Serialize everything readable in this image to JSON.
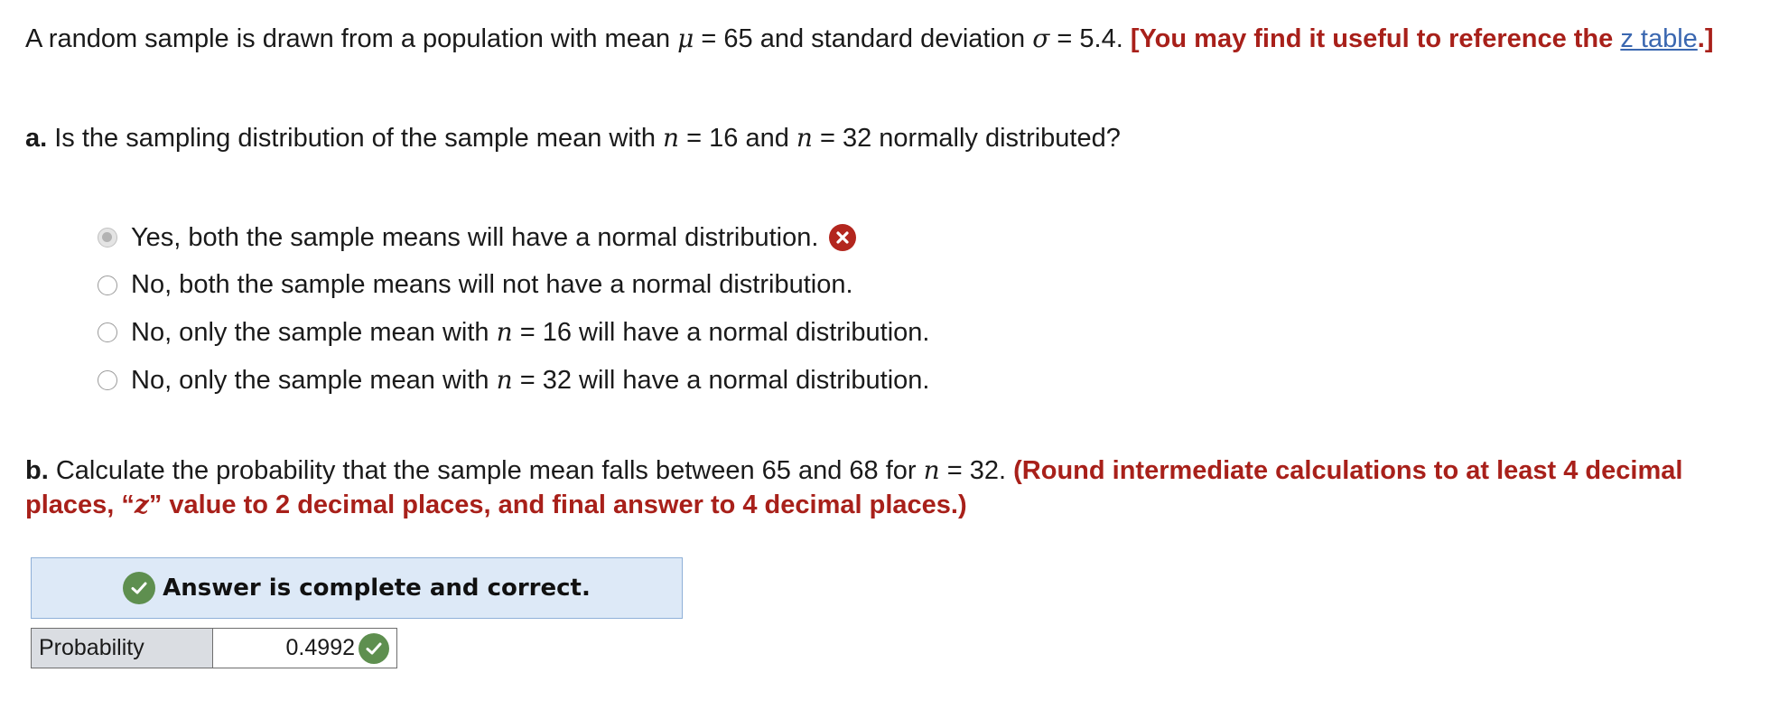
{
  "intro": {
    "text_before_mu": "A random sample is drawn from a population with mean ",
    "mu_symbol": "μ",
    "mu_value": " = 65 and standard deviation ",
    "sigma_symbol": "σ",
    "sigma_value": " = 5.4. ",
    "hint_open": "[You may find it useful to reference the ",
    "link_text": "z table",
    "hint_close": ".]"
  },
  "part_a": {
    "label": "a.",
    "question_before_n1": " Is the sampling distribution of the sample mean with ",
    "n_symbol": "n",
    "n1": " = 16 and ",
    "n2": " = 32 normally distributed?",
    "options": [
      {
        "text": "Yes, both the sample means will have a normal distribution.",
        "selected": true,
        "marked_incorrect": true
      },
      {
        "text": "No, both the sample means will not have a normal distribution.",
        "selected": false
      },
      {
        "before": "No, only the sample mean with ",
        "after": " = 16 will have a normal distribution.",
        "selected": false
      },
      {
        "before": "No, only the sample mean with ",
        "after": " = 32 will have a normal distribution.",
        "selected": false
      }
    ]
  },
  "part_b": {
    "label": "b.",
    "question_before_n": " Calculate the probability that the sample mean falls between 65 and 68 for  ",
    "n_symbol": "n",
    "n_value": " = 32. ",
    "instructions_1": "(Round intermediate calculations to at least 4 decimal places, “",
    "z_symbol": "z",
    "instructions_2": "” value to 2 decimal places, and final answer to 4 decimal places.)"
  },
  "answer": {
    "banner": "Answer is complete and correct.",
    "row_label": "Probability",
    "row_value": "0.4992"
  },
  "colors": {
    "accent_red": "#a8201a",
    "link_blue": "#3a67b0",
    "correct_green": "#5e8f4f",
    "incorrect_red": "#b3261e",
    "banner_bg": "#dde9f7",
    "label_cell_bg": "#dadde2"
  },
  "icons": {
    "incorrect": "x-circle-icon",
    "correct": "check-circle-icon"
  }
}
